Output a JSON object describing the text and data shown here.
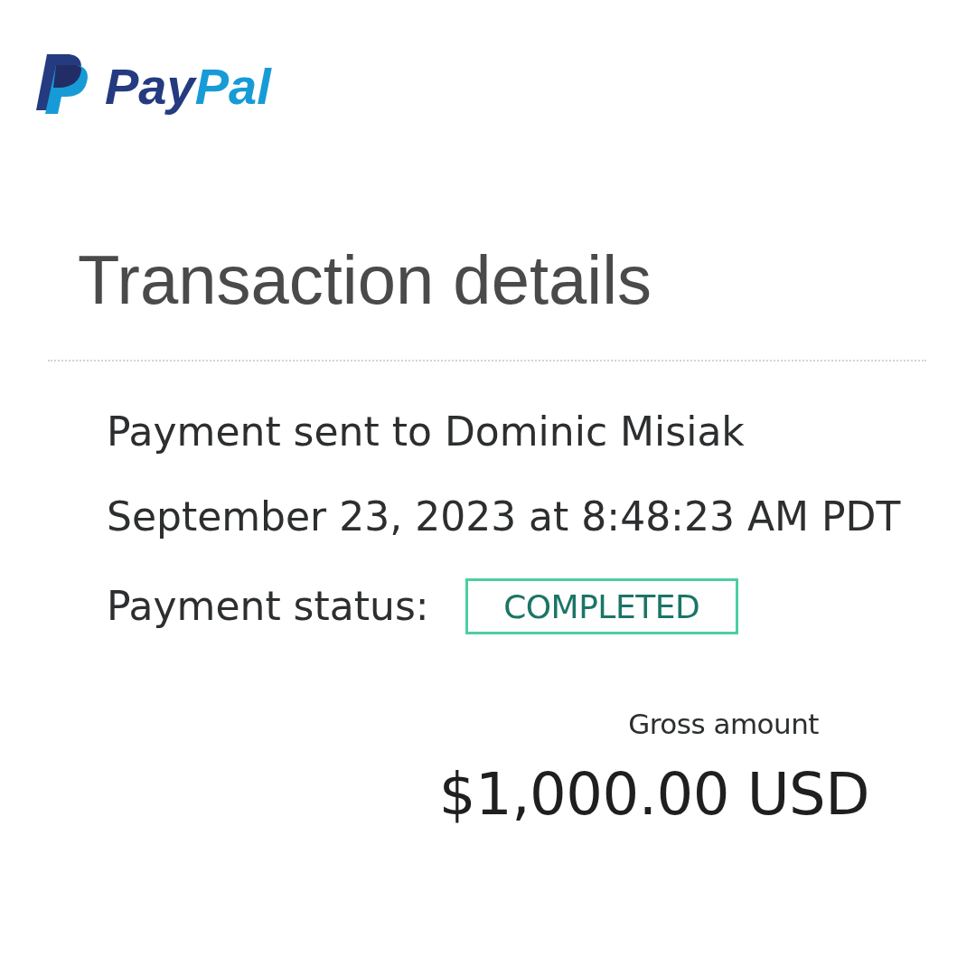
{
  "logo": {
    "parts": [
      {
        "text": "Pay",
        "color": "#253b80"
      },
      {
        "text": "Pal",
        "color": "#179bd7"
      }
    ]
  },
  "title": "Transaction details",
  "details": {
    "recipient_line": "Payment sent to Dominic Misiak",
    "date_line": "September 23, 2023 at 8:48:23 AM PDT",
    "status_label": "Payment status:",
    "status_value": "COMPLETED"
  },
  "amount": {
    "label": "Gross amount",
    "value": "$1,000.00 USD"
  }
}
